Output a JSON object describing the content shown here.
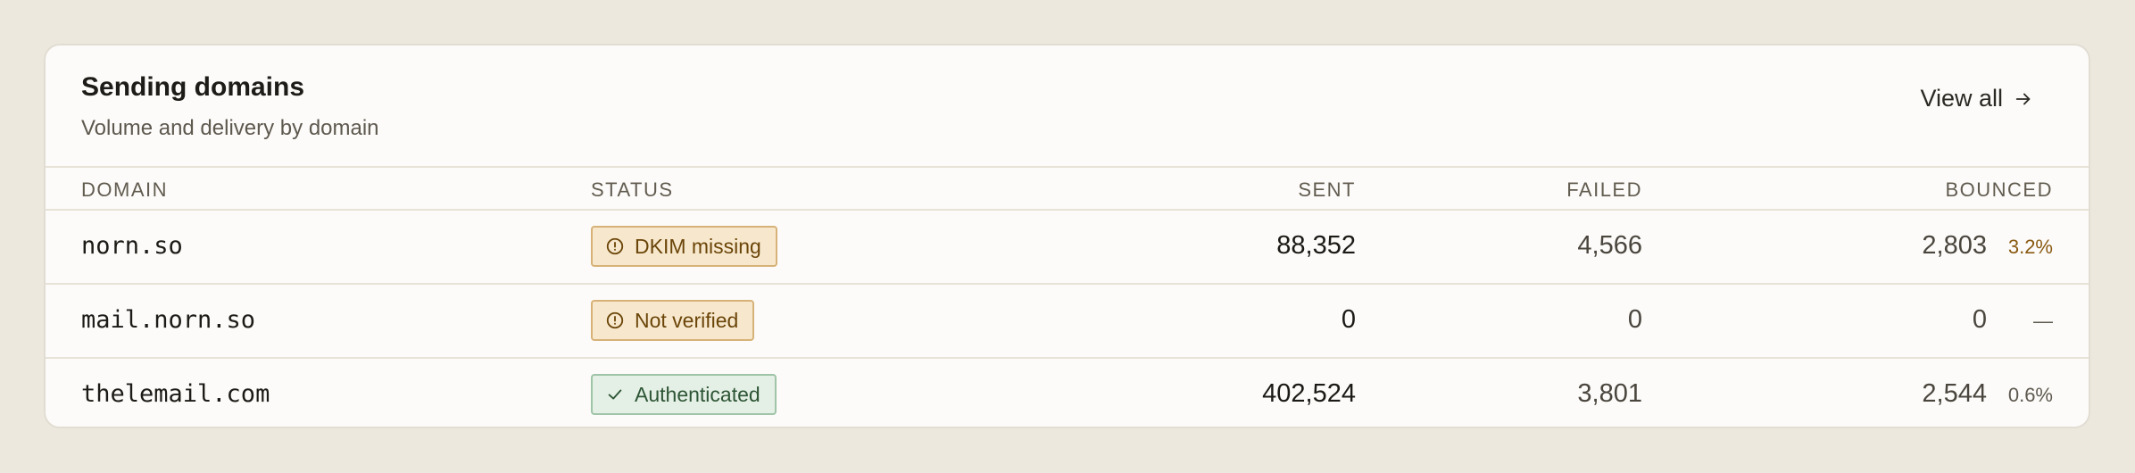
{
  "header": {
    "title": "Sending domains",
    "subtitle": "Volume and delivery by domain",
    "view_all_label": "View all"
  },
  "table": {
    "columns": [
      "DOMAIN",
      "STATUS",
      "SENT",
      "FAILED",
      "BOUNCED"
    ],
    "rows": [
      {
        "domain": "norn.so",
        "status": "DKIM missing",
        "status_type": "warning",
        "status_icon": "alert-circle-icon",
        "sent": "88,352",
        "failed": "4,566",
        "bounced": "2,803",
        "bounce_rate": "3.2%",
        "bounce_rate_tone": "warning"
      },
      {
        "domain": "mail.norn.so",
        "status": "Not verified",
        "status_type": "warning",
        "status_icon": "alert-circle-icon",
        "sent": "0",
        "failed": "0",
        "bounced": "0",
        "bounce_rate": "—",
        "bounce_rate_tone": "normal"
      },
      {
        "domain": "thelemail.com",
        "status": "Authenticated",
        "status_type": "success",
        "status_icon": "check-icon",
        "sent": "402,524",
        "failed": "3,801",
        "bounced": "2,544",
        "bounce_rate": "0.6%",
        "bounce_rate_tone": "normal"
      }
    ]
  },
  "colors": {
    "page_background": "#ede8dd",
    "card_background": "#fcfbf9",
    "warning_badge_bg": "#f7e8cd",
    "warning_badge_text": "#6b4509",
    "success_badge_bg": "#e4efe5",
    "success_badge_text": "#2d5535"
  }
}
